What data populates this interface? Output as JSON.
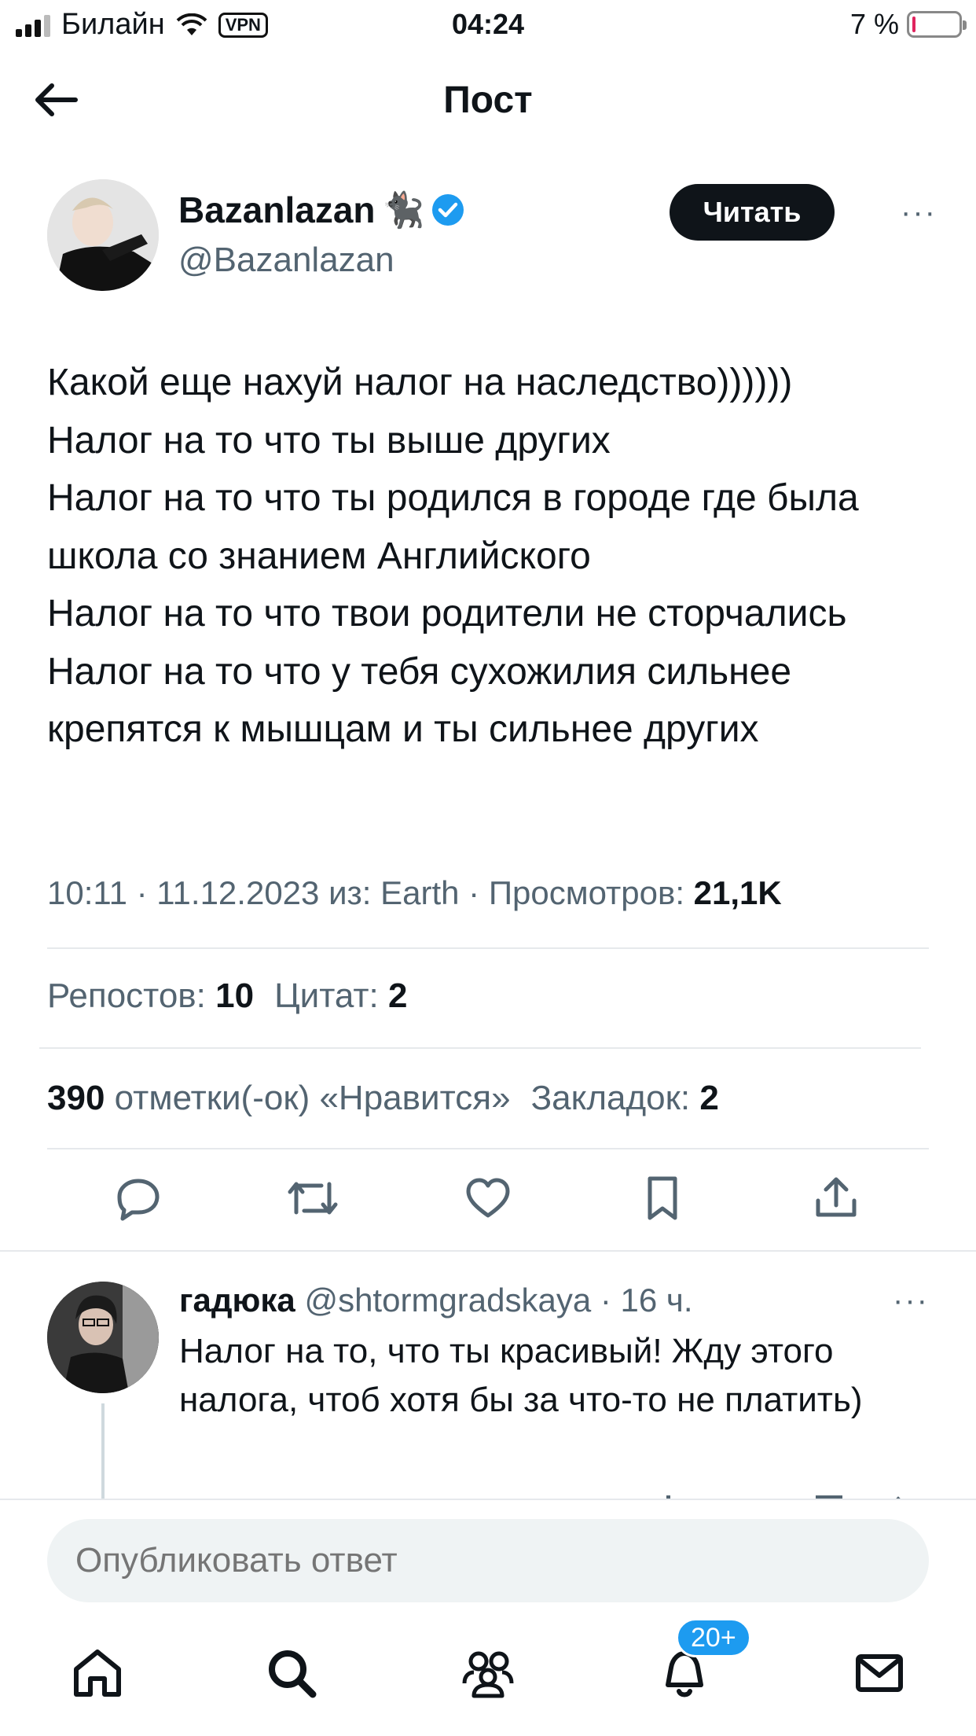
{
  "status_bar": {
    "carrier": "Билайн",
    "vpn": "VPN",
    "time": "04:24",
    "battery": "7 %",
    "battery_level": 0.07
  },
  "header": {
    "title": "Пост"
  },
  "author": {
    "name": "Bazanlazan",
    "emoji": "🐈‍⬛",
    "handle": "@Bazanlazan",
    "follow_label": "Читать",
    "more": "···"
  },
  "tweet": {
    "text": "Какой еще нахуй налог на наследство))))))\nНалог на то что ты выше других\nНалог на то что ты родился в городе где была школа со знанием Английского\nНалог на то что твои родители не сторчались\nНалог на то что у тебя сухожилия сильнее крепятся к мышцам и ты сильнее других",
    "meta": "10:11 · 11.12.2023 из: Earth · Просмотров: ",
    "views": "21,1K"
  },
  "stats": {
    "reposts_label": "Репостов:",
    "reposts": "10",
    "quotes_label": "Цитат:",
    "quotes": "2",
    "likes": "390",
    "likes_label": "отметки(-ок) «Нравится»",
    "bookmarks_label": "Закладок:",
    "bookmarks": "2"
  },
  "actions": [
    "reply-icon",
    "repost-icon",
    "like-icon",
    "bookmark-icon",
    "share-icon"
  ],
  "reply": {
    "name": "гадюка",
    "handle": "@shtormgradskaya",
    "dot": " · ",
    "time": "16 ч.",
    "text": "Налог на то, что ты красивый! Жду этого налога, чтоб хотя бы за что-то не платить)",
    "more": "···"
  },
  "compose": {
    "placeholder": "Опубликовать ответ"
  },
  "nav": {
    "items": [
      "home-icon",
      "search-icon",
      "communities-icon",
      "notifications-icon",
      "messages-icon"
    ],
    "badge": "20+"
  },
  "colors": {
    "accent": "#1d9bf0",
    "text": "#0f1419",
    "secondary": "#536471"
  }
}
